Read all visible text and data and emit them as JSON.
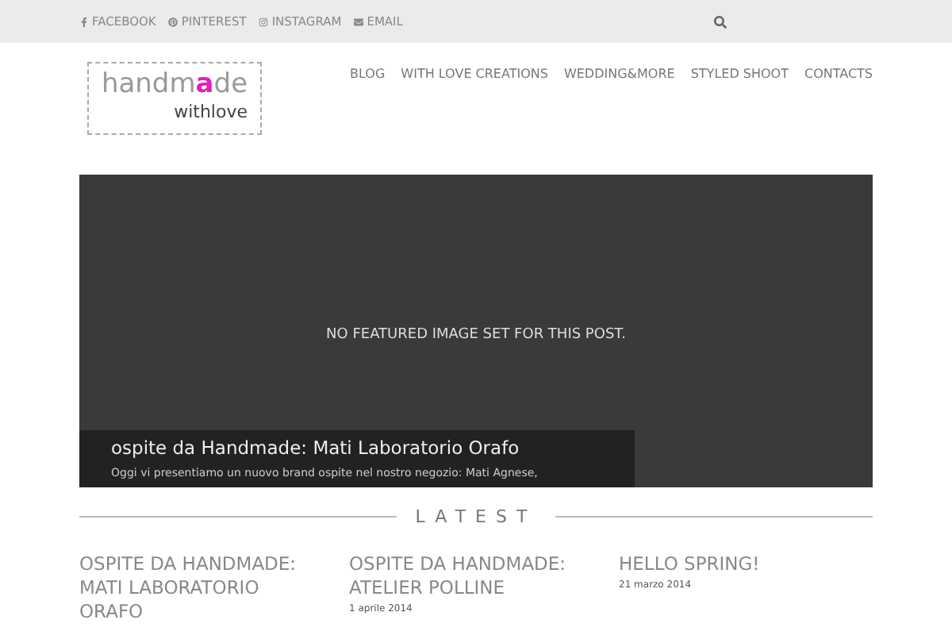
{
  "top_bar": {
    "social_links": [
      {
        "kind": "facebook",
        "label": "FACEBOOK"
      },
      {
        "kind": "pinterest",
        "label": "PINTEREST"
      },
      {
        "kind": "instagram",
        "label": "INSTAGRAM"
      },
      {
        "kind": "email",
        "label": "EMAIL"
      }
    ]
  },
  "logo": {
    "word_start": "handm",
    "heart_letter": "a",
    "word_end": "de",
    "subtitle": "withlove"
  },
  "nav": [
    "BLOG",
    "WITH LOVE CREATIONS",
    "WEDDING&MORE",
    "STYLED SHOOT",
    "CONTACTS"
  ],
  "featured": {
    "notice": "NO FEATURED IMAGE SET FOR THIS POST.",
    "title": "ospite da Handmade: Mati Laboratorio Orafo",
    "excerpt": "Oggi vi presentiamo un nuovo brand ospite nel nostro negozio: Mati Agnese,"
  },
  "latest": {
    "heading": "LATEST",
    "posts": [
      {
        "title": "OSPITE DA HANDMADE: MATI LABORATORIO ORAFO"
      },
      {
        "title": "OSPITE DA HANDMADE: ATELIER POLLINE",
        "date": "1 aprile 2014"
      },
      {
        "title": "HELLO SPRING!",
        "date": "21 marzo 2014"
      }
    ]
  }
}
